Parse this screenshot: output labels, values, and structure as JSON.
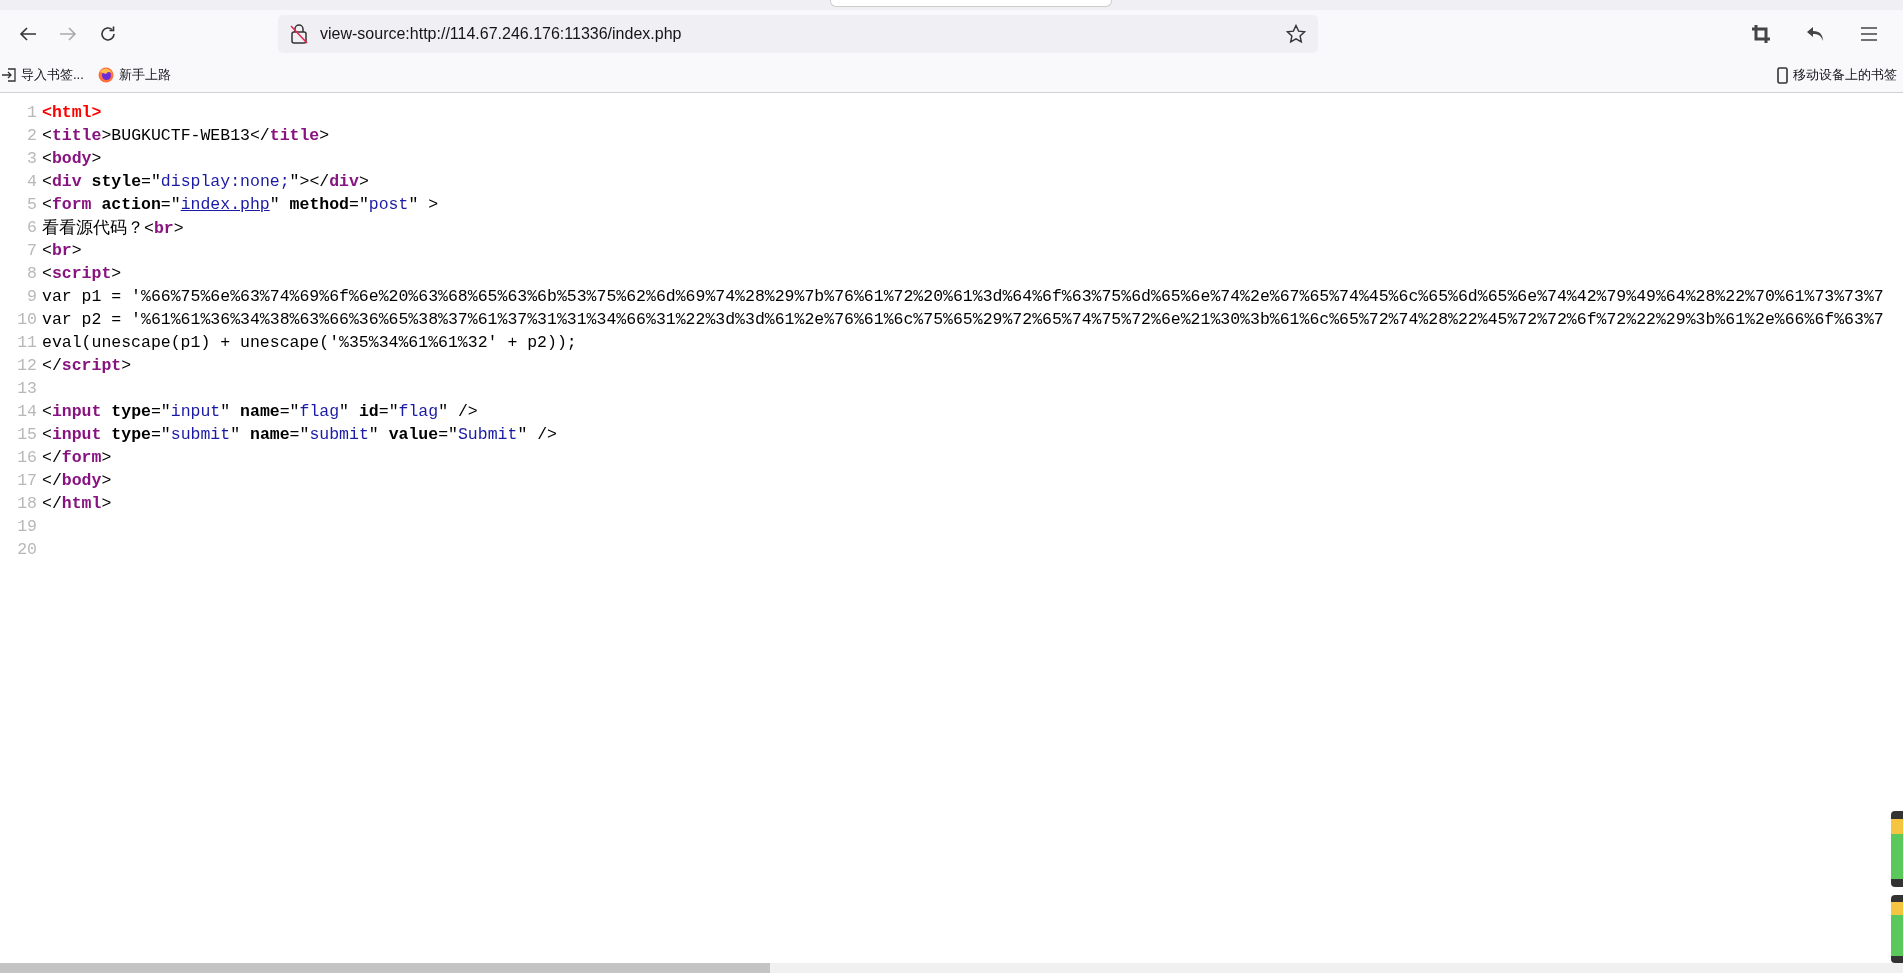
{
  "browser": {
    "address": "view-source:http://114.67.246.176:11336/index.php"
  },
  "bookmarks": [
    {
      "kind": "import",
      "label": "导入书签..."
    },
    {
      "kind": "site",
      "label": "新手上路"
    }
  ],
  "mobile_bookmarks": "移动设备上的书签",
  "source_lines": [
    {
      "number": "1",
      "tokens": [
        {
          "kind": "error",
          "text": "<html>"
        }
      ]
    },
    {
      "number": "2",
      "tokens": [
        {
          "kind": "punct",
          "text": "<"
        },
        {
          "kind": "tag",
          "text": "title"
        },
        {
          "kind": "punct",
          "text": ">BUGKUCTF-WEB13</"
        },
        {
          "kind": "tag",
          "text": "title"
        },
        {
          "kind": "punct",
          "text": ">"
        }
      ]
    },
    {
      "number": "3",
      "tokens": [
        {
          "kind": "punct",
          "text": "<"
        },
        {
          "kind": "tag",
          "text": "body"
        },
        {
          "kind": "punct",
          "text": ">"
        }
      ]
    },
    {
      "number": "4",
      "tokens": [
        {
          "kind": "punct",
          "text": "<"
        },
        {
          "kind": "tag",
          "text": "div"
        },
        {
          "kind": "attr",
          "text": " style"
        },
        {
          "kind": "punct",
          "text": "=\""
        },
        {
          "kind": "value",
          "text": "display:none;"
        },
        {
          "kind": "punct",
          "text": "\"></"
        },
        {
          "kind": "tag",
          "text": "div"
        },
        {
          "kind": "punct",
          "text": ">"
        }
      ]
    },
    {
      "number": "5",
      "tokens": [
        {
          "kind": "punct",
          "text": "<"
        },
        {
          "kind": "tag",
          "text": "form"
        },
        {
          "kind": "attr",
          "text": " action"
        },
        {
          "kind": "punct",
          "text": "=\""
        },
        {
          "kind": "link",
          "text": "index.php"
        },
        {
          "kind": "punct",
          "text": "\" "
        },
        {
          "kind": "attr",
          "text": "method"
        },
        {
          "kind": "punct",
          "text": "=\""
        },
        {
          "kind": "value",
          "text": "post"
        },
        {
          "kind": "punct",
          "text": "\" >"
        }
      ]
    },
    {
      "number": "6",
      "tokens": [
        {
          "kind": "punct",
          "text": "看看源代码？<"
        },
        {
          "kind": "tag",
          "text": "br"
        },
        {
          "kind": "punct",
          "text": ">"
        }
      ]
    },
    {
      "number": "7",
      "tokens": [
        {
          "kind": "punct",
          "text": "<"
        },
        {
          "kind": "tag",
          "text": "br"
        },
        {
          "kind": "punct",
          "text": ">"
        }
      ]
    },
    {
      "number": "8",
      "tokens": [
        {
          "kind": "punct",
          "text": "<"
        },
        {
          "kind": "tag",
          "text": "script"
        },
        {
          "kind": "punct",
          "text": ">"
        }
      ]
    },
    {
      "number": "9",
      "tokens": [
        {
          "kind": "punct",
          "text": "var p1 = '%66%75%6e%63%74%69%6f%6e%20%63%68%65%63%6b%53%75%62%6d%69%74%28%29%7b%76%61%72%20%61%3d%64%6f%63%75%6d%65%6e%74%2e%67%65%74%45%6c%65%6d%65%6e%74%42%79%49%64%28%22%70%61%73%73%7"
        }
      ]
    },
    {
      "number": "10",
      "tokens": [
        {
          "kind": "punct",
          "text": "var p2 = '%61%61%36%34%38%63%66%36%65%38%37%61%37%31%31%34%66%31%22%3d%3d%61%2e%76%61%6c%75%65%29%72%65%74%75%72%6e%21%30%3b%61%6c%65%72%74%28%22%45%72%72%6f%72%22%29%3b%61%2e%66%6f%63%7"
        }
      ]
    },
    {
      "number": "11",
      "tokens": [
        {
          "kind": "punct",
          "text": "eval(unescape(p1) + unescape('%35%34%61%61%32' + p2));"
        }
      ]
    },
    {
      "number": "12",
      "tokens": [
        {
          "kind": "punct",
          "text": "</"
        },
        {
          "kind": "tag",
          "text": "script"
        },
        {
          "kind": "punct",
          "text": ">"
        }
      ]
    },
    {
      "number": "13"
    },
    {
      "number": "14",
      "tokens": [
        {
          "kind": "punct",
          "text": "<"
        },
        {
          "kind": "tag",
          "text": "input"
        },
        {
          "kind": "attr",
          "text": " type"
        },
        {
          "kind": "punct",
          "text": "=\""
        },
        {
          "kind": "value",
          "text": "input"
        },
        {
          "kind": "punct",
          "text": "\" "
        },
        {
          "kind": "attr",
          "text": "name"
        },
        {
          "kind": "punct",
          "text": "=\""
        },
        {
          "kind": "value",
          "text": "flag"
        },
        {
          "kind": "punct",
          "text": "\" "
        },
        {
          "kind": "attr",
          "text": "id"
        },
        {
          "kind": "punct",
          "text": "=\""
        },
        {
          "kind": "value",
          "text": "flag"
        },
        {
          "kind": "punct",
          "text": "\" />"
        }
      ]
    },
    {
      "number": "15",
      "tokens": [
        {
          "kind": "punct",
          "text": "<"
        },
        {
          "kind": "tag",
          "text": "input"
        },
        {
          "kind": "attr",
          "text": " type"
        },
        {
          "kind": "punct",
          "text": "=\""
        },
        {
          "kind": "value",
          "text": "submit"
        },
        {
          "kind": "punct",
          "text": "\" "
        },
        {
          "kind": "attr",
          "text": "name"
        },
        {
          "kind": "punct",
          "text": "=\""
        },
        {
          "kind": "value",
          "text": "submit"
        },
        {
          "kind": "punct",
          "text": "\" "
        },
        {
          "kind": "attr",
          "text": "value"
        },
        {
          "kind": "punct",
          "text": "=\""
        },
        {
          "kind": "value",
          "text": "Submit"
        },
        {
          "kind": "punct",
          "text": "\" />"
        }
      ]
    },
    {
      "number": "16",
      "tokens": [
        {
          "kind": "punct",
          "text": "</"
        },
        {
          "kind": "tag",
          "text": "form"
        },
        {
          "kind": "punct",
          "text": ">"
        }
      ]
    },
    {
      "number": "17",
      "tokens": [
        {
          "kind": "punct",
          "text": "</"
        },
        {
          "kind": "tag",
          "text": "body"
        },
        {
          "kind": "punct",
          "text": ">"
        }
      ]
    },
    {
      "number": "18",
      "tokens": [
        {
          "kind": "punct",
          "text": "</"
        },
        {
          "kind": "tag",
          "text": "html"
        },
        {
          "kind": "punct",
          "text": ">"
        }
      ]
    },
    {
      "number": "19"
    },
    {
      "number": "20"
    }
  ]
}
